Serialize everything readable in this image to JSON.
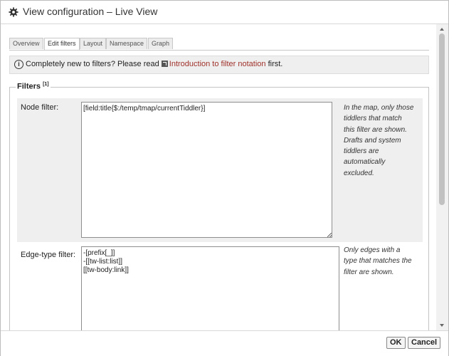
{
  "window": {
    "title": "View configuration – Live View",
    "title_icon": "gear-icon"
  },
  "tabs": [
    {
      "label": "Overview",
      "active": false
    },
    {
      "label": "Edit filters",
      "active": true
    },
    {
      "label": "Layout",
      "active": false
    },
    {
      "label": "Namespace",
      "active": false
    },
    {
      "label": "Graph",
      "active": false
    }
  ],
  "notice": {
    "icon": "info-icon",
    "prefix": "Completely new to filters? Please read ",
    "link_icon": "external-link-icon",
    "link_text": "Introduction to filter notation",
    "suffix": " first."
  },
  "filters": {
    "legend": "Filters",
    "legend_sup": "[1]",
    "node_filter": {
      "label": "Node filter:",
      "value": "[field:title{$:/temp/tmap/currentTiddler}]",
      "hint_lines": [
        "In the map, only those",
        "tiddlers that match",
        "this filter are shown.",
        "Drafts and system",
        "tiddlers are",
        "automatically",
        "excluded."
      ]
    },
    "edge_filter": {
      "label": "Edge-type filter:",
      "value": "-[prefix[_]]\n-[[tw-list:list]]\n[[tw-body:link]]",
      "hint_lines": [
        "Only edges with a",
        "type that matches the",
        "filter are shown."
      ]
    }
  },
  "footer": {
    "ok_label": "OK",
    "cancel_label": "Cancel"
  }
}
